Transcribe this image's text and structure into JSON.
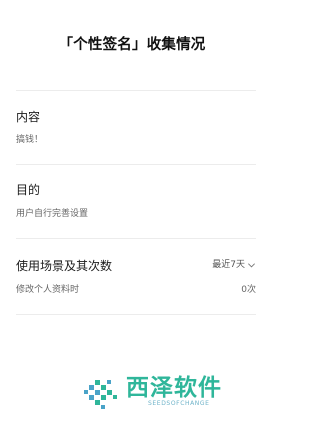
{
  "header": {
    "title": "「个性签名」收集情况"
  },
  "sections": {
    "content": {
      "label": "内容",
      "value": "搞钱！"
    },
    "purpose": {
      "label": "目的",
      "value": "用户自行完善设置"
    },
    "usage": {
      "label": "使用场景及其次数",
      "filter_label": "最近7天",
      "scenario": "修改个人资料时",
      "count": "0次"
    }
  },
  "watermark": {
    "brand": "西泽软件",
    "tagline": "SEEDSOFCHANGE"
  },
  "colors": {
    "divider": "#ececec",
    "watermark_green": "#2fb69a",
    "watermark_blue": "#4aa3c8"
  }
}
